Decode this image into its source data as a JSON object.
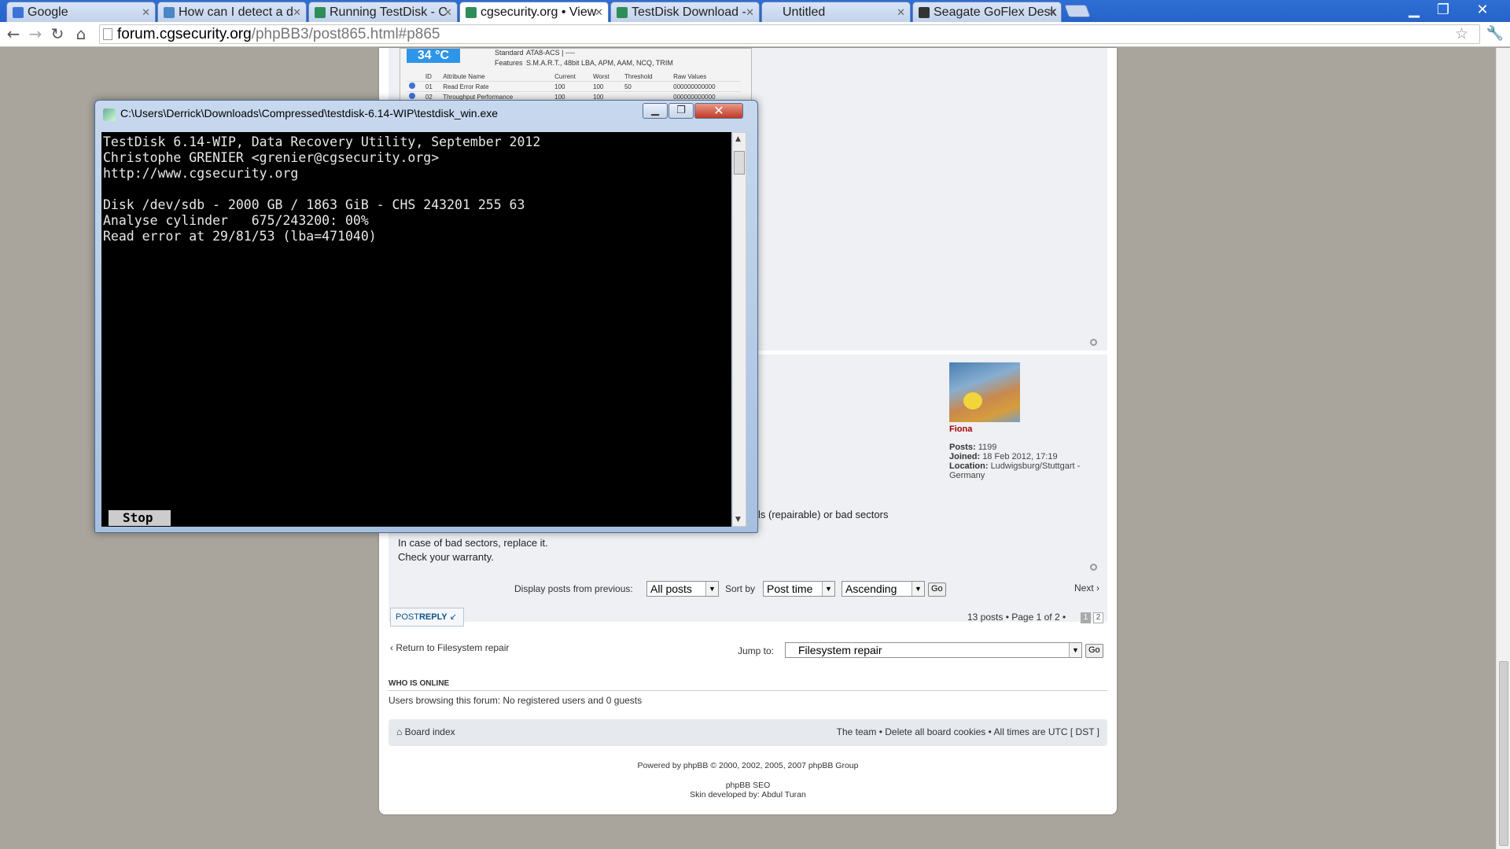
{
  "browser": {
    "tabs": [
      {
        "label": "Google",
        "favicon_color": "#3b73d9"
      },
      {
        "label": "How can I detect a d",
        "favicon_color": "#4a86c8"
      },
      {
        "label": "Running TestDisk - C",
        "favicon_color": "#2f8d57"
      },
      {
        "label": "cgsecurity.org • View",
        "favicon_color": "#2f8d57"
      },
      {
        "label": "TestDisk Download -",
        "favicon_color": "#2f8d57"
      },
      {
        "label": "Untitled",
        "favicon_color": ""
      },
      {
        "label": "Seagate GoFlex Desk",
        "favicon_color": "#333333"
      }
    ],
    "active_tab": 3,
    "url_host": "forum.cgsecurity.org",
    "url_path": "/phpBB3/post865.html#p865"
  },
  "smart_image": {
    "temperature": "34 °C",
    "standard_label": "Standard",
    "standard_value": "ATA8-ACS | ----",
    "features_label": "Features",
    "features_value": "S.M.A.R.T., 48bit LBA, APM, AAM, NCQ, TRIM",
    "columns": [
      "ID",
      "Attribute Name",
      "Current",
      "Worst",
      "Threshold",
      "Raw Values"
    ],
    "rows": [
      [
        "01",
        "Read Error Rate",
        "100",
        "100",
        "50",
        "000000000000"
      ],
      [
        "02",
        "Throughput Performance",
        "100",
        "100",
        "",
        "000000000000"
      ]
    ]
  },
  "profile": {
    "username": "Fiona",
    "posts_label": "Posts:",
    "posts_value": "1199",
    "joined_label": "Joined:",
    "joined_value": "18 Feb 2012, 17:19",
    "location_label": "Location:",
    "location_value": "Ludwigsburg/Stuttgart - Germany"
  },
  "post": {
    "line1_visible": "ls (repairable) or bad sectors",
    "line2": "In case of bad sectors, replace it.",
    "line3": "Check your warranty."
  },
  "sort_bar": {
    "display_label": "Display posts from previous:",
    "display_value": "All posts",
    "sort_label": "Sort by",
    "sort_value": "Post time",
    "order_value": "Ascending",
    "go": "Go",
    "next": "Next"
  },
  "pagination": {
    "post_reply_a": "POST",
    "post_reply_b": "REPLY",
    "summary": "13 posts • Page 1 of 2 •",
    "pages": [
      "1",
      "2"
    ],
    "current_page": "1"
  },
  "jump": {
    "return_link": "Return to Filesystem repair",
    "jump_label": "Jump to:",
    "jump_value": "Filesystem repair",
    "go": "Go"
  },
  "online": {
    "heading": "WHO IS ONLINE",
    "text": "Users browsing this forum: No registered users and 0 guests"
  },
  "footer": {
    "board_index": "Board index",
    "team": "The team",
    "delete_cookies": "Delete all board cookies",
    "times": "• All times are UTC [ DST ]",
    "powered": "Powered by phpBB © 2000, 2002, 2005, 2007 phpBB Group",
    "seo": "phpBB SEO",
    "skin": "Skin developed by: Abdul Turan"
  },
  "testdisk": {
    "title": "C:\\Users\\Derrick\\Downloads\\Compressed\\testdisk-6.14-WIP\\testdisk_win.exe",
    "lines": [
      "TestDisk 6.14-WIP, Data Recovery Utility, September 2012",
      "Christophe GRENIER <grenier@cgsecurity.org>",
      "http://www.cgsecurity.org",
      "",
      "Disk /dev/sdb - 2000 GB / 1863 GiB - CHS 243201 255 63",
      "Analyse cylinder   675/243200: 00%",
      "Read error at 29/81/53 (lba=471040)"
    ],
    "stop_label": "Stop"
  }
}
